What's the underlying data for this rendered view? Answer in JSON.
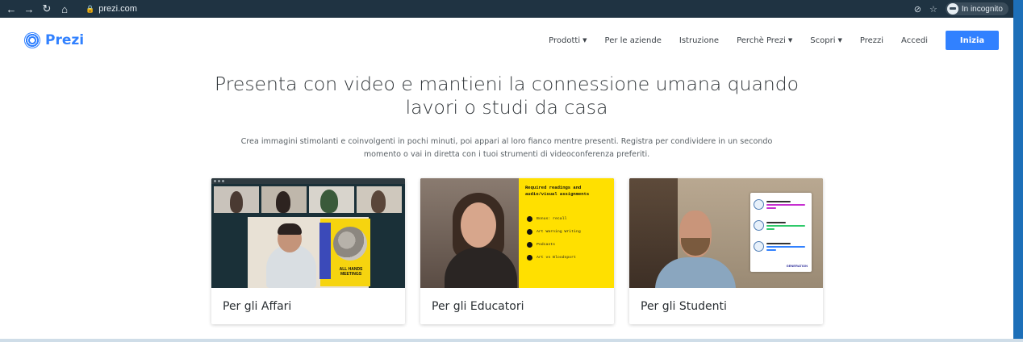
{
  "browser": {
    "url": "prezi.com",
    "incognito_label": "In incognito",
    "icons": [
      "back-icon",
      "forward-icon",
      "reload-icon",
      "home-icon",
      "lock-icon",
      "eye-off-icon",
      "star-icon",
      "incognito-icon"
    ]
  },
  "nav": {
    "logo_text": "Prezi",
    "items": [
      {
        "label": "Prodotti",
        "dropdown": true
      },
      {
        "label": "Per le aziende",
        "dropdown": false
      },
      {
        "label": "Istruzione",
        "dropdown": false
      },
      {
        "label": "Perchè Prezi",
        "dropdown": true
      },
      {
        "label": "Scopri",
        "dropdown": true
      },
      {
        "label": "Prezzi",
        "dropdown": false
      },
      {
        "label": "Accedi",
        "dropdown": false
      }
    ],
    "cta_label": "Inizia"
  },
  "hero": {
    "title_line1": "Presenta con video e mantieni la connessione umana quando",
    "title_line2": "lavori o studi da casa",
    "subtitle_line1": "Crea immagini stimolanti e coinvolgenti in pochi minuti, poi appari al loro fianco mentre presenti. Registra per condividere in un secondo",
    "subtitle_line2": "momento o vai in diretta con i tuoi strumenti di videoconferenza preferiti."
  },
  "cards": [
    {
      "label": "Per gli Affari",
      "media_text": "ALL HANDS MEETINGS"
    },
    {
      "label": "Per gli Educatori",
      "media_heading": "Required readings and audio/visual assignments",
      "media_items": [
        "Bonus: recall",
        "Art Warning Writing",
        "Podcasts",
        "Art vs Bloodsport"
      ]
    },
    {
      "label": "Per gli Studenti",
      "media_text": "GENERATION"
    }
  ],
  "colors": {
    "brand": "#3181ff",
    "chrome_bg": "#1f3342",
    "accent_yellow": "#ffe000"
  }
}
